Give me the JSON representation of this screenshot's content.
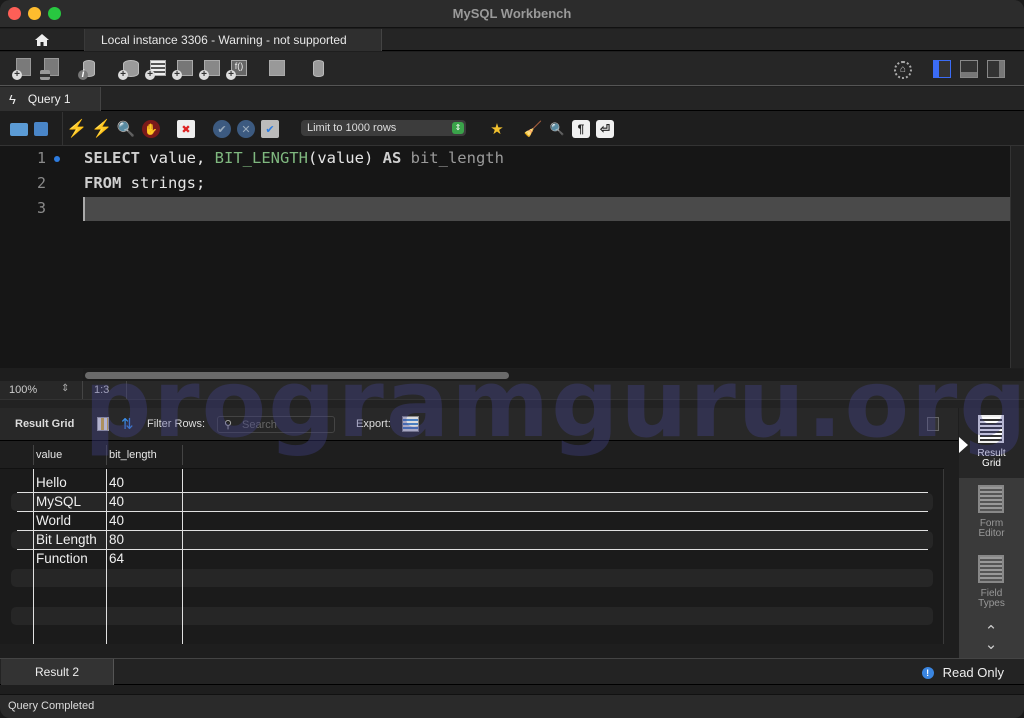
{
  "window": {
    "title": "MySQL Workbench"
  },
  "connection_tabs": {
    "home_icon": "home-icon",
    "active_tab": "Local instance 3306 - Warning - not supported"
  },
  "main_toolbar": {
    "icons": [
      "new-sql-tab-icon",
      "open-sql-file-icon",
      "schema-inspector-icon",
      "create-schema-icon",
      "create-table-icon",
      "create-view-icon",
      "create-procedure-icon",
      "create-function-icon",
      "search-table-data-icon",
      "reconnect-icon"
    ],
    "right_icons": [
      "preferences-gear-icon",
      "toggle-sidebar-icon",
      "toggle-output-panel-icon",
      "toggle-secondary-sidebar-icon"
    ]
  },
  "query_tabs": [
    {
      "label": "Query 1",
      "icon": "lightning-icon"
    }
  ],
  "sql_toolbar": {
    "limit_select": "Limit to 1000 rows"
  },
  "editor": {
    "line_numbers": [
      "1",
      "2",
      "3"
    ],
    "lines": [
      {
        "tokens": [
          {
            "t": "SELECT",
            "c": "kw"
          },
          {
            "t": " value, ",
            "c": ""
          },
          {
            "t": "BIT_LENGTH",
            "c": "fn"
          },
          {
            "t": "(value) ",
            "c": ""
          },
          {
            "t": "AS",
            "c": "kw"
          },
          {
            "t": " bit_length",
            "c": "id2"
          }
        ]
      },
      {
        "tokens": [
          {
            "t": "FROM",
            "c": "kw"
          },
          {
            "t": " strings;",
            "c": ""
          }
        ]
      },
      {
        "tokens": []
      }
    ],
    "zoom": "100%",
    "cursor_position": "1:3"
  },
  "result_toolbar": {
    "title": "Result Grid",
    "filter_label": "Filter Rows:",
    "search_placeholder": "Search",
    "search_value": "",
    "export_label": "Export:"
  },
  "result_grid": {
    "columns": [
      "value",
      "bit_length"
    ],
    "rows": [
      [
        "Hello",
        "40"
      ],
      [
        "MySQL",
        "40"
      ],
      [
        "World",
        "40"
      ],
      [
        "Bit Length",
        "80"
      ],
      [
        "Function",
        "64"
      ]
    ]
  },
  "side_panel": {
    "items": [
      {
        "label_1": "Result",
        "label_2": "Grid",
        "active": true
      },
      {
        "label_1": "Form",
        "label_2": "Editor",
        "active": false
      },
      {
        "label_1": "Field",
        "label_2": "Types",
        "active": false
      }
    ]
  },
  "bottom_tabs": [
    {
      "label": "Result 2"
    }
  ],
  "read_only": "Read Only",
  "status": "Query Completed",
  "watermark": "programguru.org"
}
